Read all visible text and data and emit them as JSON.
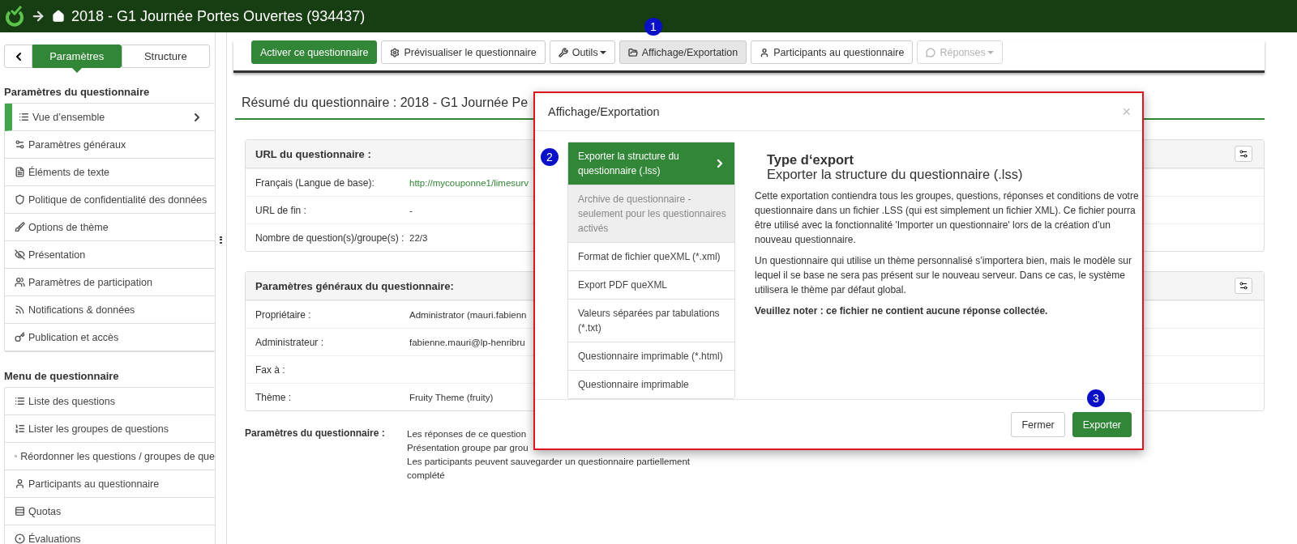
{
  "header": {
    "title": "2018 - G1 Journée Portes Ouvertes (934437)"
  },
  "sidebar": {
    "tabs": [
      {
        "label": "Paramètres",
        "selected": true
      },
      {
        "label": "Structure",
        "selected": false
      }
    ],
    "sections": [
      {
        "title": "Paramètres du questionnaire",
        "items": [
          {
            "label": "Vue d’ensemble",
            "selected": true
          },
          {
            "label": "Paramètres généraux",
            "selected": false
          },
          {
            "label": "Éléments de texte",
            "selected": false
          },
          {
            "label": "Politique de confidentialité des données",
            "selected": false
          },
          {
            "label": "Options de thème",
            "selected": false
          },
          {
            "label": "Présentation",
            "selected": false
          },
          {
            "label": "Paramètres de participation",
            "selected": false
          },
          {
            "label": "Notifications & données",
            "selected": false
          },
          {
            "label": "Publication et accès",
            "selected": false
          }
        ]
      },
      {
        "title": "Menu de questionnaire",
        "items": [
          {
            "label": "Liste des questions",
            "selected": false
          },
          {
            "label": "Lister les groupes de questions",
            "selected": false
          },
          {
            "label": "Réordonner les questions / groupes de que",
            "selected": false
          },
          {
            "label": "Participants au questionnaire",
            "selected": false
          },
          {
            "label": "Quotas",
            "selected": false
          },
          {
            "label": "Évaluations",
            "selected": false
          }
        ]
      }
    ]
  },
  "toolbar": [
    {
      "label": "Activer ce questionnaire",
      "kind": "primary",
      "selected": false,
      "disabled": false,
      "dropdown": false
    },
    {
      "label": "Prévisualiser le questionnaire",
      "kind": "default",
      "selected": false,
      "disabled": false,
      "dropdown": false
    },
    {
      "label": "Outils",
      "kind": "default",
      "selected": false,
      "disabled": false,
      "dropdown": true
    },
    {
      "label": "Affichage/Exportation",
      "kind": "default",
      "selected": true,
      "disabled": false,
      "dropdown": false
    },
    {
      "label": "Participants au questionnaire",
      "kind": "default",
      "selected": false,
      "disabled": false,
      "dropdown": false
    },
    {
      "label": "Réponses",
      "kind": "default",
      "selected": false,
      "disabled": true,
      "dropdown": true
    }
  ],
  "page_title": "Résumé du questionnaire : 2018 - G1 Journée Pe",
  "panels": [
    {
      "title": "URL du questionnaire :",
      "rows": [
        {
          "label": "Français (Langue de base):",
          "value": "http://mycouponne1/limesurv",
          "kind": "link"
        },
        {
          "label": "URL de fin :",
          "value": "-",
          "kind": "text"
        },
        {
          "label": "Nombre de question(s)/groupe(s) :",
          "value": "22/3",
          "kind": "text"
        }
      ]
    },
    {
      "title": "Paramètres généraux du questionnaire:",
      "rows": [
        {
          "label": "Propriétaire :",
          "value": "Administrator (mauri.fabienn",
          "kind": "text"
        },
        {
          "label": "Administrateur :",
          "value": "fabienne.mauri@lp-henribru",
          "kind": "text"
        },
        {
          "label": "Fax à :",
          "kind": "text"
        },
        {
          "label": "Thème :",
          "value": "Fruity Theme (fruity)",
          "kind": "text"
        }
      ]
    }
  ],
  "settings": {
    "label": "Paramètres du questionnaire :",
    "lines": [
      "Les réponses de ce question",
      "Présentation groupe par grou",
      "Les participants peuvent sauvegarder un questionnaire partiellement complété"
    ]
  },
  "modal": {
    "title": "Affichage/Exportation",
    "close": "×",
    "options": [
      {
        "label": "Exporter la structure du questionnaire (.lss)",
        "selected": true,
        "disabled": false
      },
      {
        "label": "Archive de questionnaire - seulement pour les questionnaires activés",
        "selected": false,
        "disabled": true
      },
      {
        "label": "Format de fichier queXML (*.xml)",
        "selected": false,
        "disabled": false
      },
      {
        "label": "Export PDF queXML",
        "selected": false,
        "disabled": false
      },
      {
        "label": "Valeurs séparées par tabulations (*.txt)",
        "selected": false,
        "disabled": false
      },
      {
        "label": "Questionnaire imprimable (*.html)",
        "selected": false,
        "disabled": false
      },
      {
        "label": "Questionnaire imprimable",
        "selected": false,
        "disabled": false
      }
    ],
    "heading": "Type d‘export",
    "subheading": "Exporter la structure du questionnaire (.lss)",
    "paragraphs": [
      "Cette exportation contiendra tous les groupes, questions, réponses et conditions de votre questionnaire dans un fichier .LSS (qui est simplement un fichier XML). Ce fichier pourra être utilisé avec la fonctionnalité 'Importer un questionnaire' lors de la création d’un nouveau questionnaire.",
      "Un questionnaire qui utilise un thème personnalisé s’importera bien, mais le modèle sur lequel il se base ne sera pas présent sur le nouveau serveur. Dans ce cas, le système utilisera le thème par défaut global."
    ],
    "note": "Veuillez noter : ce fichier ne contient aucune réponse collectée.",
    "buttons": [
      {
        "label": "Fermer",
        "kind": "default"
      },
      {
        "label": "Exporter",
        "kind": "primary"
      }
    ]
  },
  "markers": [
    "1",
    "2",
    "3"
  ]
}
